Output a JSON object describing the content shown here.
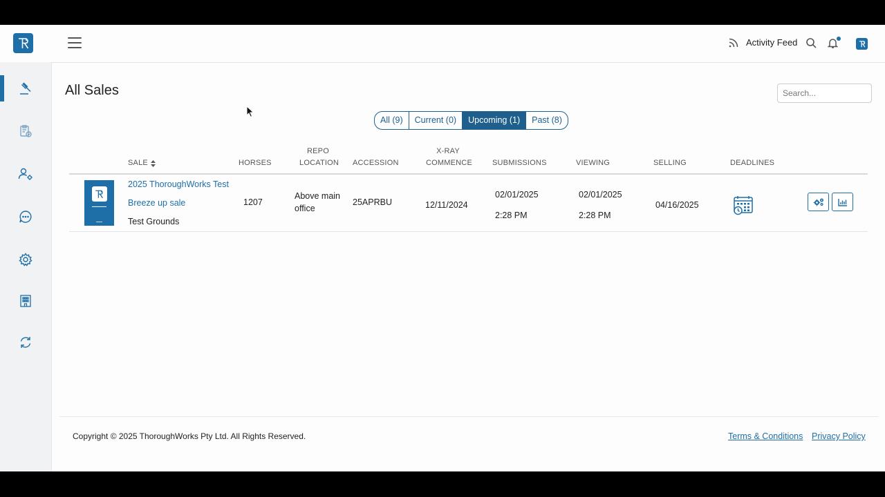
{
  "brand": {
    "logo_letter": "R",
    "accent": "#1e6ea8"
  },
  "sidebar": {
    "items": [
      {
        "icon": "gavel-icon",
        "active": true
      },
      {
        "icon": "clipboard-check-icon"
      },
      {
        "icon": "user-settings-icon"
      },
      {
        "icon": "chat-bubble-icon"
      },
      {
        "icon": "gear-icon"
      },
      {
        "icon": "building-icon"
      },
      {
        "icon": "refresh-icon"
      }
    ]
  },
  "header": {
    "activity_feed_label": "Activity Feed",
    "icons": [
      "rss-feed-icon",
      "search-icon",
      "bell-icon",
      "profile-avatar-icon"
    ]
  },
  "page": {
    "title": "All Sales",
    "search_placeholder": "Search..."
  },
  "filters": [
    {
      "label": "All (9)",
      "active": false
    },
    {
      "label": "Current (0)",
      "active": false
    },
    {
      "label": "Upcoming (1)",
      "active": true
    },
    {
      "label": "Past (8)",
      "active": false
    }
  ],
  "table": {
    "headers": {
      "sale": "SALE",
      "horses": "HORSES",
      "repo_location_1": "REPO",
      "repo_location_2": "LOCATION",
      "accession": "ACCESSION",
      "xray_1": "X-RAY",
      "xray_2": "COMMENCE",
      "submissions": "SUBMISSIONS",
      "viewing": "VIEWING",
      "selling": "SELLING",
      "deadlines": "DEADLINES"
    },
    "rows": [
      {
        "sale_name": "2025 ThoroughWorks Test",
        "sale_type": "Breeze up sale",
        "venue": "Test Grounds",
        "horses": "1207",
        "repo_location_1": "Above main",
        "repo_location_2": "office",
        "accession": "25APRBU",
        "xray_commence": "12/11/2024",
        "submissions_date": "02/01/2025",
        "submissions_time": "2:28 PM",
        "viewing_date": "02/01/2025",
        "viewing_time": "2:28 PM",
        "selling": "04/16/2025",
        "deadlines_icon": "calendar-clock-icon",
        "actions": [
          "settings-gears-icon",
          "bar-chart-icon"
        ]
      }
    ]
  },
  "footer": {
    "copyright": "Copyright © 2025 ThoroughWorks Pty Ltd. All Rights Reserved.",
    "terms": "Terms & Conditions",
    "privacy": "Privacy Policy"
  }
}
